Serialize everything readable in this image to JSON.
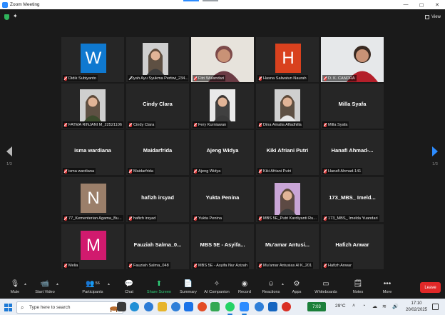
{
  "window": {
    "title": "Zoom Meeting"
  },
  "topbar": {
    "view_label": "View"
  },
  "pagination": {
    "left": "1/3",
    "right": "1/3"
  },
  "colors": {
    "speaking_border": "#c6d94a",
    "share_green": "#2fd17a",
    "leave_red": "#e02828",
    "accent_blue": "#2d8cff"
  },
  "tiles": [
    {
      "label": "Didik Subiyanto",
      "kind": "box",
      "letter": "W",
      "box_color": "#0f79d0"
    },
    {
      "label": "Dyah Ayu Syukma Pertiwi_234...",
      "kind": "photo"
    },
    {
      "label": "Fitri Wulandari",
      "kind": "video",
      "speaking": true
    },
    {
      "label": "Hasna Salwatun Naurah",
      "kind": "box",
      "letter": "H",
      "box_color": "#d9411e"
    },
    {
      "label": "D. K. CANDRA",
      "kind": "video"
    },
    {
      "label": "FATMA RINJANI M_22521106",
      "kind": "photo"
    },
    {
      "label": "Cindy Clara",
      "kind": "name",
      "name": "Cindy Clara"
    },
    {
      "label": "Fery Kurniawan",
      "kind": "photo"
    },
    {
      "label": "Dina Amalia Alfadhilla",
      "kind": "photo"
    },
    {
      "label": "Milla Syafa",
      "kind": "name",
      "name": "Milla Syafa"
    },
    {
      "label": "isma wardiana",
      "kind": "name",
      "name": "isma wardiana"
    },
    {
      "label": "Maidarfrida",
      "kind": "name",
      "name": "Maidarfrida"
    },
    {
      "label": "Ajeng Widya",
      "kind": "name",
      "name": "Ajeng Widya"
    },
    {
      "label": "Kiki Afriani Putri",
      "kind": "name",
      "name": "Kiki Afriani Putri"
    },
    {
      "label": "Hanafi Ahmad-141",
      "kind": "name",
      "name": "Hanafi Ahmad-..."
    },
    {
      "label": "77_Kementerian Agama_Bu...",
      "kind": "box",
      "letter": "N",
      "box_color": "#9b7f6a"
    },
    {
      "label": "hafizh irsyad",
      "kind": "name",
      "name": "hafizh irsyad"
    },
    {
      "label": "Yukta Penina",
      "kind": "name",
      "name": "Yukta Penina"
    },
    {
      "label": "MBS 5E_Putri Kardiyanti Ru...",
      "kind": "photo"
    },
    {
      "label": "173_MBS_ Imelda Yuandari",
      "kind": "name",
      "name": "173_MBS_ Imeld..."
    },
    {
      "label": "Melia",
      "kind": "box",
      "letter": "M",
      "box_color": "#d11a6e"
    },
    {
      "label": "Fauziah Salma_048",
      "kind": "name",
      "name": "Fauziah Salma_0..."
    },
    {
      "label": "MBS 5E - Asyifa Nur Azizah",
      "kind": "name",
      "name": "MBS 5E - Asyifa..."
    },
    {
      "label": "Mu'amar Antusias Al K_201",
      "kind": "name",
      "name": "Mu'amar Antusi..."
    },
    {
      "label": "Hafizh Anwar",
      "kind": "name",
      "name": "Hafizh Anwar"
    }
  ],
  "toolbar": {
    "mute": "Mute",
    "start_video": "Start Video",
    "participants": "Participants",
    "participants_count": "56",
    "chat": "Chat",
    "share_screen": "Share Screen",
    "summary": "Summary",
    "ai_companion": "AI Companion",
    "record": "Record",
    "reactions": "Reactions",
    "apps": "Apps",
    "whiteboards": "Whiteboards",
    "notes": "Notes",
    "more": "More",
    "leave": "Leave"
  },
  "taskbar": {
    "search_placeholder": "Type here to search",
    "market": "7:03",
    "weather": "29°C",
    "time": "17:10",
    "date": "20/02/2025"
  }
}
